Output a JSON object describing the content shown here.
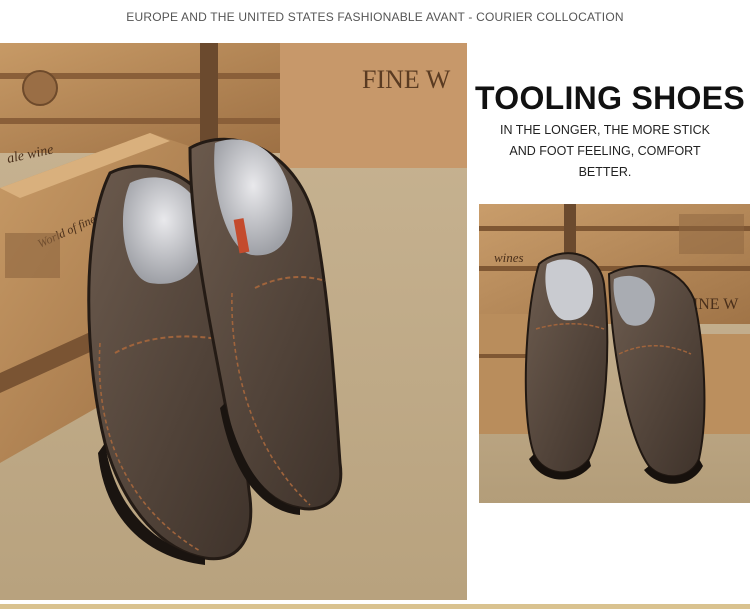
{
  "header": {
    "tagline": "EUROPE AND THE UNITED STATES FASHIONABLE AVANT - COURIER COLLOCATION"
  },
  "feature": {
    "title": "TOOLING SHOES",
    "description_lines": [
      "IN THE LONGER, THE MORE STICK",
      "AND FOOT FEELING, COMFORT",
      "BETTER."
    ]
  },
  "main_photo": {
    "crate_text_1": "FINE W",
    "crate_text_2": "ale wine",
    "crate_text_3": "World of fine wine"
  },
  "side_photo": {
    "crate_text_1": "FINE W",
    "crate_text_2": "wines"
  },
  "colors": {
    "shoe": "#5a4a3f",
    "stitching": "#a0643c",
    "wood": "#b88a5a",
    "accent_bar": "#d9c28f"
  }
}
